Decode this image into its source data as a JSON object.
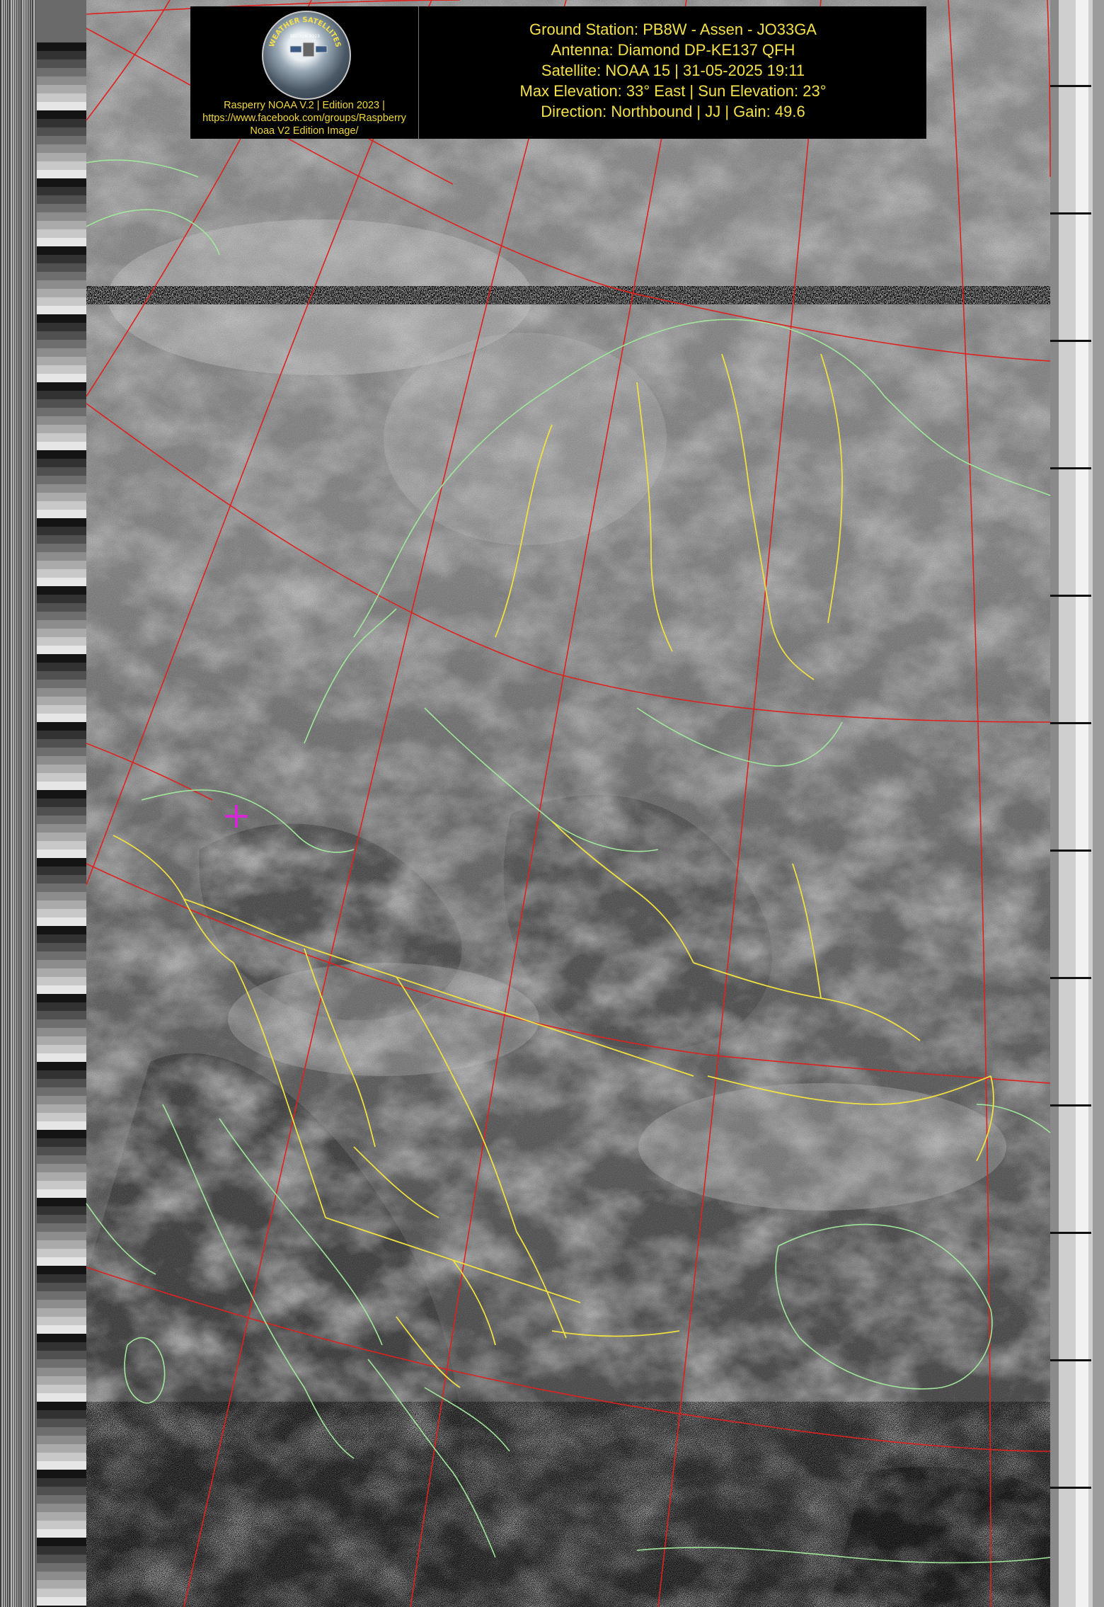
{
  "logo": {
    "ring_text": "WEATHER SATELLITES",
    "edition_badge": "EDITION 2023",
    "caption_lines": [
      "Rasperry NOAA V.2 | Edition 2023 |",
      "https://www.facebook.com/groups/Raspberry",
      "Noaa V2 Edition Image/"
    ]
  },
  "station": {
    "lines": [
      "Ground Station: PB8W - Assen - JO33GA",
      "Antenna: Diamond DP-KE137 QFH",
      "Satellite: NOAA 15 | 31-05-2025 19:11",
      "Max Elevation: 33° East | Sun Elevation: 23°",
      "Direction: Northbound | JJ | Gain: 49.6"
    ]
  },
  "colors": {
    "header_text": "#f4e04a",
    "logo_caption": "#f2d73a",
    "graticule": "#e0211d",
    "borders": "#f0e040",
    "coastlines": "#9fe89a",
    "station_marker": "#d428d4"
  },
  "icons": {
    "station_marker": "plus-marker-icon",
    "logo": "satellite-logo-icon"
  }
}
